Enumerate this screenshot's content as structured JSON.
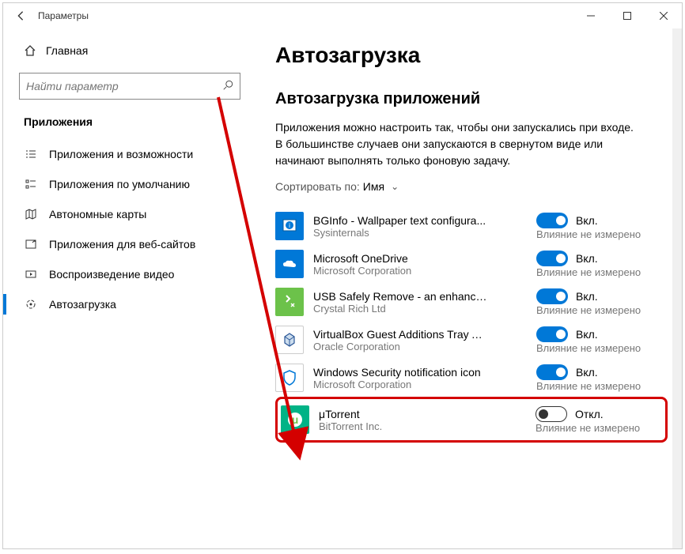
{
  "titlebar": {
    "title": "Параметры"
  },
  "sidebar": {
    "home": "Главная",
    "search_placeholder": "Найти параметр",
    "section": "Приложения",
    "items": [
      {
        "label": "Приложения и возможности"
      },
      {
        "label": "Приложения по умолчанию"
      },
      {
        "label": "Автономные карты"
      },
      {
        "label": "Приложения для веб-сайтов"
      },
      {
        "label": "Воспроизведение видео"
      },
      {
        "label": "Автозагрузка"
      }
    ]
  },
  "main": {
    "heading": "Автозагрузка",
    "subheading": "Автозагрузка приложений",
    "description": "Приложения можно настроить так, чтобы они запускались при входе. В большинстве случаев они запускаются в свернутом виде или начинают выполнять только фоновую задачу.",
    "sort_label": "Сортировать по:",
    "sort_value": "Имя",
    "on_text": "Вкл.",
    "off_text": "Откл.",
    "impact_text": "Влияние не измерено",
    "apps": [
      {
        "name": "BGInfo - Wallpaper text configura...",
        "publisher": "Sysinternals",
        "on": true,
        "icon": "bginfo"
      },
      {
        "name": "Microsoft OneDrive",
        "publisher": "Microsoft Corporation",
        "on": true,
        "icon": "onedrive"
      },
      {
        "name": "USB Safely Remove - an enhance...",
        "publisher": "Crystal Rich Ltd",
        "on": true,
        "icon": "usb"
      },
      {
        "name": "VirtualBox Guest Additions Tray A...",
        "publisher": "Oracle Corporation",
        "on": true,
        "icon": "vbox"
      },
      {
        "name": "Windows Security notification icon",
        "publisher": "Microsoft Corporation",
        "on": true,
        "icon": "shield"
      },
      {
        "name": "μTorrent",
        "publisher": "BitTorrent Inc.",
        "on": false,
        "icon": "utorrent"
      }
    ]
  }
}
